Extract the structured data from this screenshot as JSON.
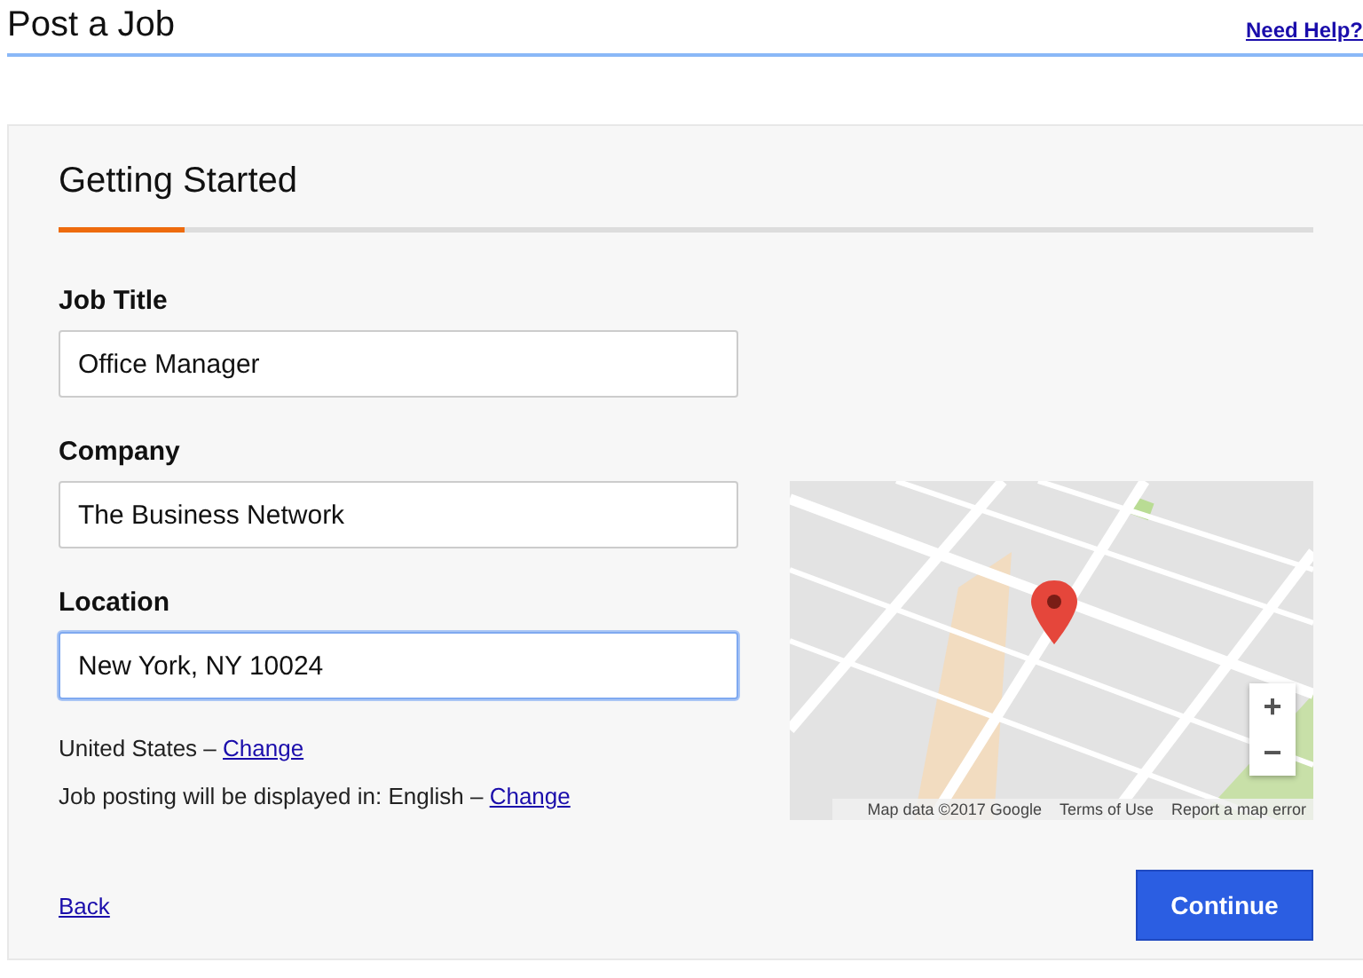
{
  "header": {
    "title": "Post a Job",
    "help_link": "Need Help?"
  },
  "section": {
    "title": "Getting Started",
    "progress": {
      "level": 0.1
    }
  },
  "fields": [
    {
      "label": "Job Title",
      "value": "Office Manager",
      "focused": false
    },
    {
      "label": "Company",
      "value": "The Business Network",
      "focused": false
    },
    {
      "label": "Location",
      "value": "New York, NY 10024",
      "focused": true
    }
  ],
  "notes": [
    {
      "text": "United States –",
      "link": "Change"
    },
    {
      "text": "Job posting will be displayed in: English –",
      "link": "Change"
    }
  ],
  "map": {
    "zoom_in": "+",
    "zoom_out": "−",
    "attribution": [
      "Map data ©2017 Google",
      "Terms of Use",
      "Report a map error"
    ]
  },
  "footer": {
    "back": "Back",
    "continue": "Continue"
  }
}
